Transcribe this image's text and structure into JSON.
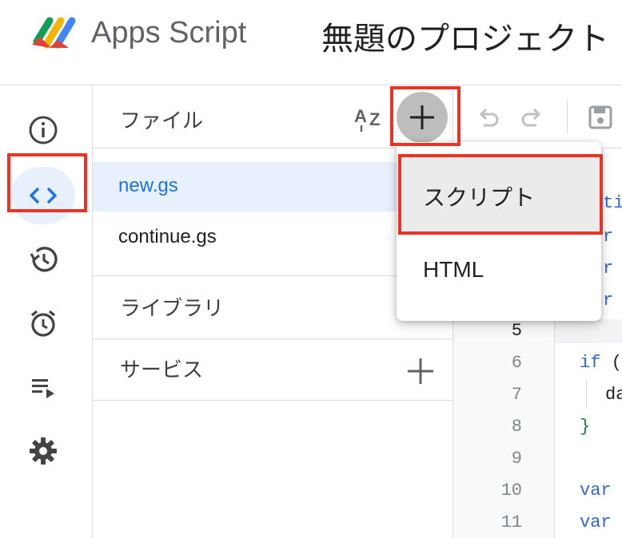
{
  "header": {
    "app_title": "Apps Script",
    "project_title": "無題のプロジェクト"
  },
  "rail": {
    "items": [
      {
        "name": "overview",
        "icon": "info-icon"
      },
      {
        "name": "editor",
        "icon": "code-icon",
        "active": true
      },
      {
        "name": "executions-history",
        "icon": "history-icon"
      },
      {
        "name": "triggers",
        "icon": "alarm-icon"
      },
      {
        "name": "executions",
        "icon": "playlist-play-icon"
      },
      {
        "name": "settings",
        "icon": "gear-icon"
      }
    ]
  },
  "files": {
    "section_label": "ファイル",
    "items": [
      {
        "name": "new.gs",
        "active": true
      },
      {
        "name": "continue.gs"
      }
    ]
  },
  "libraries": {
    "section_label": "ライブラリ"
  },
  "services": {
    "section_label": "サービス"
  },
  "menu": {
    "items": [
      "スクリプト",
      "HTML"
    ],
    "hovered": "スクリプト"
  },
  "editor": {
    "current_line": "5",
    "line_numbers": [
      "5",
      "6",
      "7",
      "8",
      "9",
      "10",
      "11"
    ],
    "code_fragments": {
      "line1": "ti",
      "line2": "r",
      "line3": "r",
      "line4": "r",
      "line6_kw": "if",
      "line6_rest": " (",
      "line7": "da",
      "line8": "}",
      "line10": "var",
      "line11": "var"
    }
  },
  "colors": {
    "accent": "#1a73e8",
    "highlight": "#ea3323",
    "active_bg": "#e8f0fe"
  }
}
